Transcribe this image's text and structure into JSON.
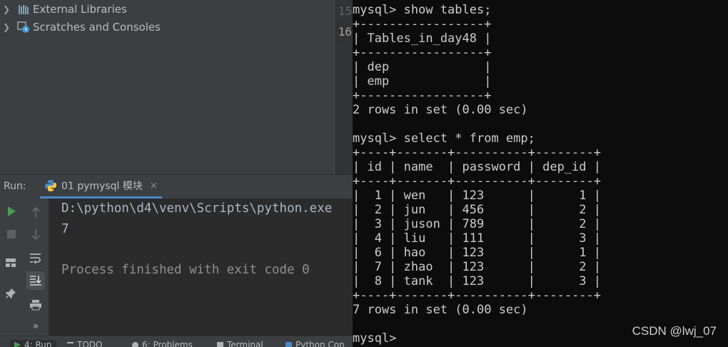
{
  "project_tree": {
    "items": [
      {
        "label": "External Libraries",
        "icon": "library-icon"
      },
      {
        "label": "Scratches and Consoles",
        "icon": "scratches-icon"
      }
    ]
  },
  "editor_gutter": {
    "line_numbers": [
      "15",
      "16"
    ],
    "current_line": "16"
  },
  "run_panel": {
    "label": "Run:",
    "tab_title": "01 pymysql 模块",
    "close_glyph": "×",
    "console_lines": [
      {
        "text": "D:\\python\\d4\\venv\\Scripts\\python.exe",
        "color": "#a9b7c6"
      },
      {
        "text": "7",
        "color": "#a9b7c6"
      },
      {
        "text": "",
        "color": "#a9b7c6"
      },
      {
        "text": "Process finished with exit code 0",
        "color": "#8f8f8f"
      }
    ],
    "more_glyph": "»"
  },
  "tool_tabs": [
    "4: Run",
    "TODO",
    "6: Problems",
    "Terminal",
    "Python Con"
  ],
  "terminal": {
    "lines": [
      "mysql> show tables;",
      "+-----------------+",
      "| Tables_in_day48 |",
      "+-----------------+",
      "| dep             |",
      "| emp             |",
      "+-----------------+",
      "2 rows in set (0.00 sec)",
      "",
      "mysql> select * from emp;",
      "+----+-------+----------+--------+",
      "| id | name  | password | dep_id |",
      "+----+-------+----------+--------+",
      "|  1 | wen   | 123      |      1 |",
      "|  2 | jun   | 456      |      2 |",
      "|  3 | juson | 789      |      2 |",
      "|  4 | liu   | 111      |      3 |",
      "|  6 | hao   | 123      |      1 |",
      "|  7 | zhao  | 123      |      2 |",
      "|  8 | tank  | 123      |      3 |",
      "+----+-------+----------+--------+",
      "7 rows in set (0.00 sec)",
      "",
      "mysql>"
    ]
  },
  "watermark": "CSDN @lwj_07",
  "colors": {
    "run_green": "#499c54",
    "accent_blue": "#4a88c7",
    "terminal_bg": "#0c0c0c",
    "ide_bg": "#3c3f41"
  }
}
